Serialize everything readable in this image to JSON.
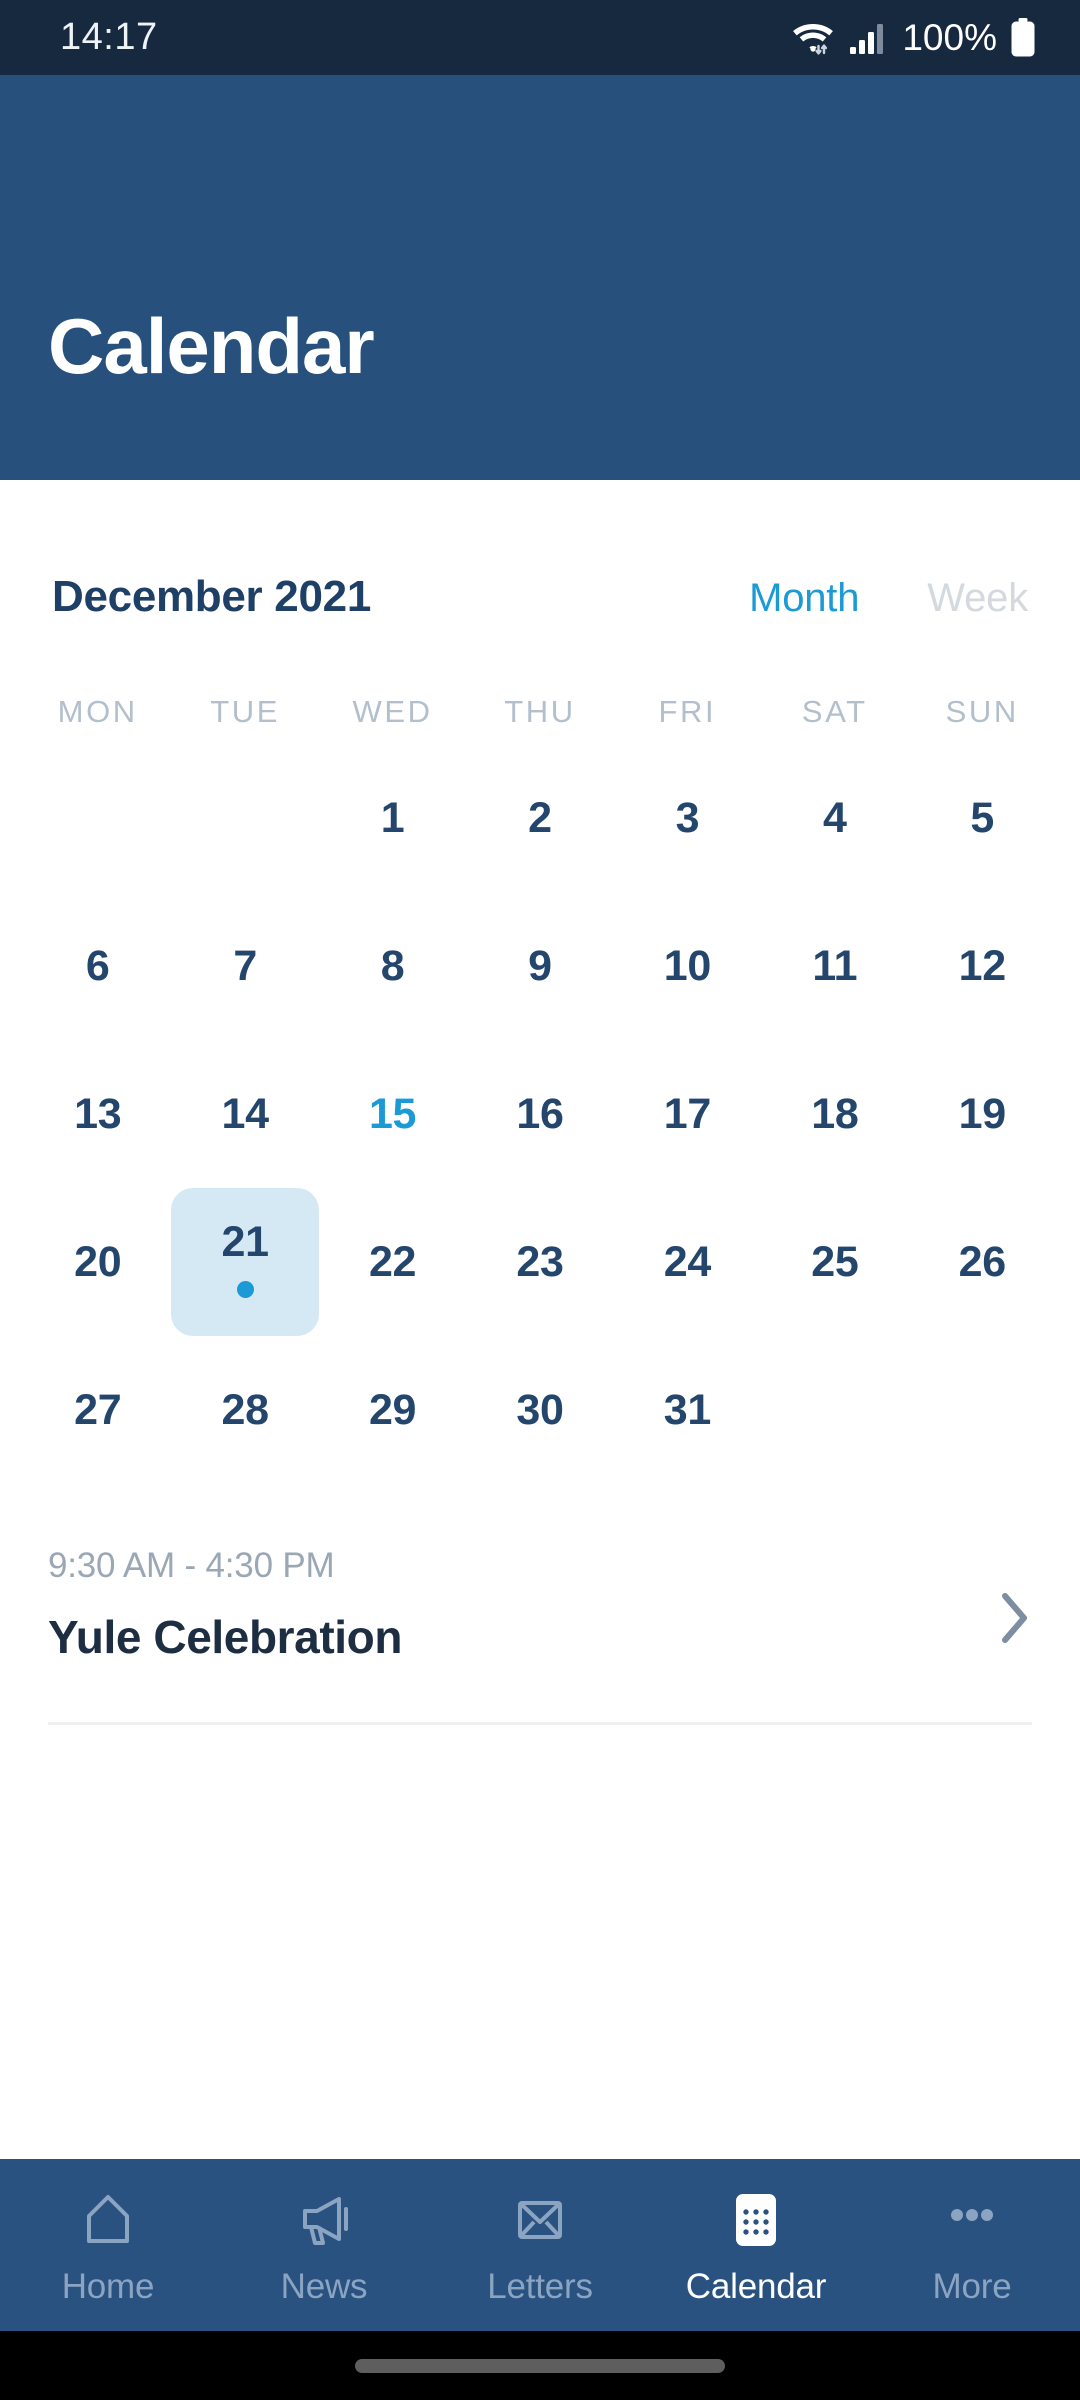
{
  "status_bar": {
    "time": "14:17",
    "battery_percent": "100%",
    "icons": [
      "wifi-icon",
      "signal-icon",
      "battery-icon"
    ]
  },
  "header": {
    "title": "Calendar"
  },
  "calendar": {
    "month_label": "December 2021",
    "view_options": [
      {
        "label": "Month",
        "active": true
      },
      {
        "label": "Week",
        "active": false
      }
    ],
    "weekdays": [
      "MON",
      "TUE",
      "WED",
      "THU",
      "FRI",
      "SAT",
      "SUN"
    ],
    "weeks": [
      [
        "",
        "",
        "1",
        "2",
        "3",
        "4",
        "5"
      ],
      [
        "6",
        "7",
        "8",
        "9",
        "10",
        "11",
        "12"
      ],
      [
        "13",
        "14",
        "15",
        "16",
        "17",
        "18",
        "19"
      ],
      [
        "20",
        "21",
        "22",
        "23",
        "24",
        "25",
        "26"
      ],
      [
        "27",
        "28",
        "29",
        "30",
        "31",
        "",
        ""
      ]
    ],
    "today": "15",
    "selected": "21",
    "days_with_events": [
      "21"
    ],
    "colors": {
      "header_bg": "#27507d",
      "status_bg": "#17293f",
      "accent": "#1b9ad6",
      "day_text": "#24466d",
      "selected_bg": "#d5e9f5",
      "nav_bg": "#2a5280",
      "weekday_text": "#b3bfcc"
    }
  },
  "events": [
    {
      "time": "9:30 AM - 4:30 PM",
      "title": "Yule Celebration",
      "chevron": "chevron-right-icon"
    }
  ],
  "bottom_nav": [
    {
      "label": "Home",
      "icon": "home-icon",
      "active": false
    },
    {
      "label": "News",
      "icon": "megaphone-icon",
      "active": false
    },
    {
      "label": "Letters",
      "icon": "envelope-icon",
      "active": false
    },
    {
      "label": "Calendar",
      "icon": "calendar-icon",
      "active": true
    },
    {
      "label": "More",
      "icon": "ellipsis-icon",
      "active": false
    }
  ]
}
